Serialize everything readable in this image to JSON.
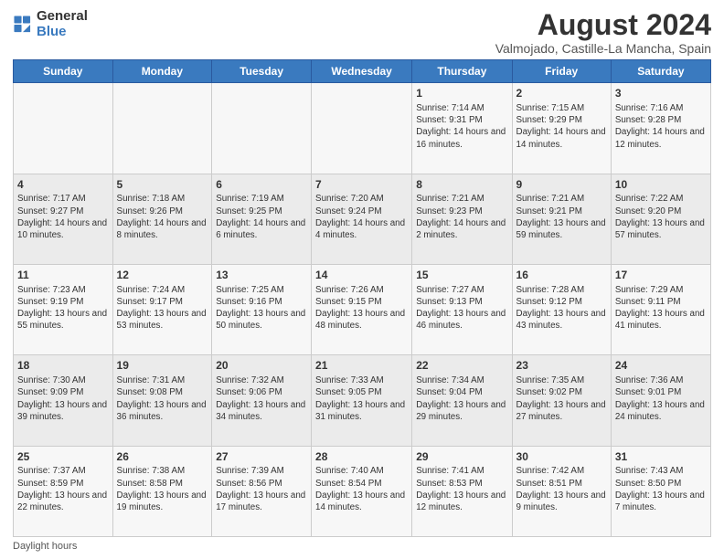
{
  "logo": {
    "general": "General",
    "blue": "Blue"
  },
  "title": "August 2024",
  "subtitle": "Valmojado, Castille-La Mancha, Spain",
  "days_of_week": [
    "Sunday",
    "Monday",
    "Tuesday",
    "Wednesday",
    "Thursday",
    "Friday",
    "Saturday"
  ],
  "weeks": [
    [
      {
        "day": "",
        "content": ""
      },
      {
        "day": "",
        "content": ""
      },
      {
        "day": "",
        "content": ""
      },
      {
        "day": "",
        "content": ""
      },
      {
        "day": "1",
        "content": "Sunrise: 7:14 AM\nSunset: 9:31 PM\nDaylight: 14 hours and 16 minutes."
      },
      {
        "day": "2",
        "content": "Sunrise: 7:15 AM\nSunset: 9:29 PM\nDaylight: 14 hours and 14 minutes."
      },
      {
        "day": "3",
        "content": "Sunrise: 7:16 AM\nSunset: 9:28 PM\nDaylight: 14 hours and 12 minutes."
      }
    ],
    [
      {
        "day": "4",
        "content": "Sunrise: 7:17 AM\nSunset: 9:27 PM\nDaylight: 14 hours and 10 minutes."
      },
      {
        "day": "5",
        "content": "Sunrise: 7:18 AM\nSunset: 9:26 PM\nDaylight: 14 hours and 8 minutes."
      },
      {
        "day": "6",
        "content": "Sunrise: 7:19 AM\nSunset: 9:25 PM\nDaylight: 14 hours and 6 minutes."
      },
      {
        "day": "7",
        "content": "Sunrise: 7:20 AM\nSunset: 9:24 PM\nDaylight: 14 hours and 4 minutes."
      },
      {
        "day": "8",
        "content": "Sunrise: 7:21 AM\nSunset: 9:23 PM\nDaylight: 14 hours and 2 minutes."
      },
      {
        "day": "9",
        "content": "Sunrise: 7:21 AM\nSunset: 9:21 PM\nDaylight: 13 hours and 59 minutes."
      },
      {
        "day": "10",
        "content": "Sunrise: 7:22 AM\nSunset: 9:20 PM\nDaylight: 13 hours and 57 minutes."
      }
    ],
    [
      {
        "day": "11",
        "content": "Sunrise: 7:23 AM\nSunset: 9:19 PM\nDaylight: 13 hours and 55 minutes."
      },
      {
        "day": "12",
        "content": "Sunrise: 7:24 AM\nSunset: 9:17 PM\nDaylight: 13 hours and 53 minutes."
      },
      {
        "day": "13",
        "content": "Sunrise: 7:25 AM\nSunset: 9:16 PM\nDaylight: 13 hours and 50 minutes."
      },
      {
        "day": "14",
        "content": "Sunrise: 7:26 AM\nSunset: 9:15 PM\nDaylight: 13 hours and 48 minutes."
      },
      {
        "day": "15",
        "content": "Sunrise: 7:27 AM\nSunset: 9:13 PM\nDaylight: 13 hours and 46 minutes."
      },
      {
        "day": "16",
        "content": "Sunrise: 7:28 AM\nSunset: 9:12 PM\nDaylight: 13 hours and 43 minutes."
      },
      {
        "day": "17",
        "content": "Sunrise: 7:29 AM\nSunset: 9:11 PM\nDaylight: 13 hours and 41 minutes."
      }
    ],
    [
      {
        "day": "18",
        "content": "Sunrise: 7:30 AM\nSunset: 9:09 PM\nDaylight: 13 hours and 39 minutes."
      },
      {
        "day": "19",
        "content": "Sunrise: 7:31 AM\nSunset: 9:08 PM\nDaylight: 13 hours and 36 minutes."
      },
      {
        "day": "20",
        "content": "Sunrise: 7:32 AM\nSunset: 9:06 PM\nDaylight: 13 hours and 34 minutes."
      },
      {
        "day": "21",
        "content": "Sunrise: 7:33 AM\nSunset: 9:05 PM\nDaylight: 13 hours and 31 minutes."
      },
      {
        "day": "22",
        "content": "Sunrise: 7:34 AM\nSunset: 9:04 PM\nDaylight: 13 hours and 29 minutes."
      },
      {
        "day": "23",
        "content": "Sunrise: 7:35 AM\nSunset: 9:02 PM\nDaylight: 13 hours and 27 minutes."
      },
      {
        "day": "24",
        "content": "Sunrise: 7:36 AM\nSunset: 9:01 PM\nDaylight: 13 hours and 24 minutes."
      }
    ],
    [
      {
        "day": "25",
        "content": "Sunrise: 7:37 AM\nSunset: 8:59 PM\nDaylight: 13 hours and 22 minutes."
      },
      {
        "day": "26",
        "content": "Sunrise: 7:38 AM\nSunset: 8:58 PM\nDaylight: 13 hours and 19 minutes."
      },
      {
        "day": "27",
        "content": "Sunrise: 7:39 AM\nSunset: 8:56 PM\nDaylight: 13 hours and 17 minutes."
      },
      {
        "day": "28",
        "content": "Sunrise: 7:40 AM\nSunset: 8:54 PM\nDaylight: 13 hours and 14 minutes."
      },
      {
        "day": "29",
        "content": "Sunrise: 7:41 AM\nSunset: 8:53 PM\nDaylight: 13 hours and 12 minutes."
      },
      {
        "day": "30",
        "content": "Sunrise: 7:42 AM\nSunset: 8:51 PM\nDaylight: 13 hours and 9 minutes."
      },
      {
        "day": "31",
        "content": "Sunrise: 7:43 AM\nSunset: 8:50 PM\nDaylight: 13 hours and 7 minutes."
      }
    ]
  ],
  "footer": "Daylight hours"
}
